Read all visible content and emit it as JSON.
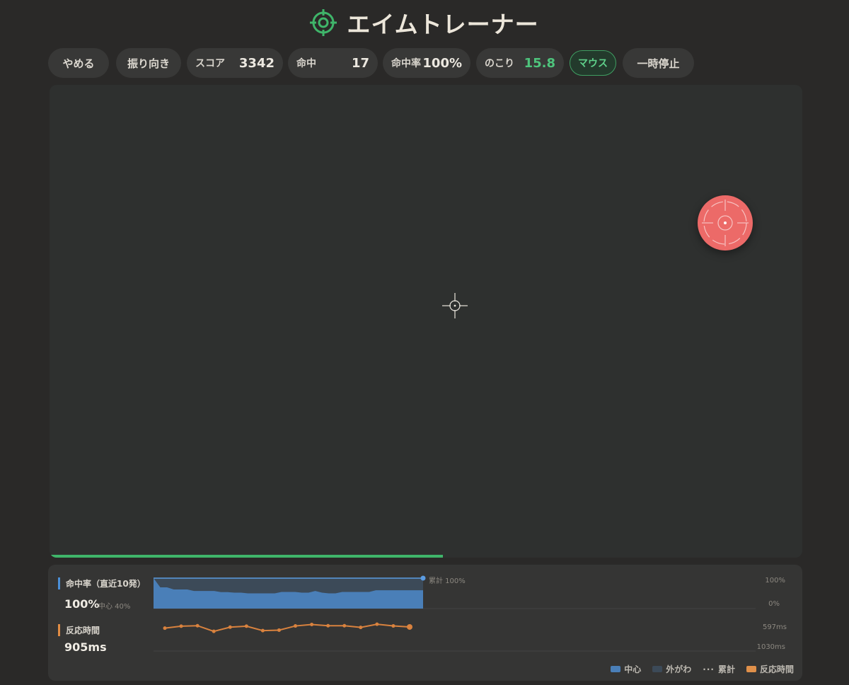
{
  "app": {
    "title": "エイムトレーナー",
    "accent": "#3fb56a"
  },
  "toolbar": {
    "quit_label": "やめる",
    "mode_select_label": "振り向き",
    "score_label": "スコア",
    "score_value": "3342",
    "hits_label": "命中",
    "hits_value": "17",
    "accuracy_label": "命中率",
    "accuracy_value": "100%",
    "remaining_label": "のこり",
    "remaining_value": "15.8",
    "input_mode_label": "マウス",
    "pause_label": "一時停止"
  },
  "arena": {
    "background": "#2e302f",
    "target_color": "#ec6a68",
    "target_icon": "target-icon",
    "cursor_icon": "crosshair-icon",
    "time_progress": 0.523
  },
  "stats": {
    "accuracy": {
      "label": "命中率（直近10発）",
      "value": "100%",
      "sub": "中心 40%",
      "cumulative_label": "累計 100%",
      "axis_top": "100%",
      "axis_bottom": "0%"
    },
    "reaction": {
      "label": "反応時間",
      "value": "905ms",
      "axis_top": "597ms",
      "axis_bottom": "1030ms"
    },
    "legend": {
      "center": "中心",
      "outer": "外がわ",
      "cumulative": "累計",
      "reaction": "反応時間"
    }
  },
  "chart_data": [
    {
      "type": "area",
      "title": "命中率（直近10発）",
      "ylim": [
        0,
        100
      ],
      "series": [
        {
          "name": "中心",
          "values": [
            100,
            62,
            62,
            53,
            53,
            53,
            47,
            47,
            47,
            47,
            42,
            42,
            40,
            40,
            37,
            37,
            37,
            37,
            37,
            43,
            43,
            43,
            40,
            40,
            47,
            40,
            37,
            37,
            43,
            43,
            43,
            43,
            43,
            50,
            50,
            50,
            50,
            50,
            50,
            50,
            50
          ]
        },
        {
          "name": "外がわ",
          "values": [
            100,
            100,
            100,
            100,
            100,
            100,
            100,
            100,
            100,
            100,
            100,
            100,
            100,
            100,
            100,
            100,
            100,
            100,
            100,
            100,
            100,
            100,
            100,
            100,
            100,
            100,
            100,
            100,
            100,
            100,
            100,
            100,
            100,
            100,
            100,
            100,
            100,
            100,
            100,
            100,
            100
          ]
        },
        {
          "name": "累計",
          "values": [
            100,
            100,
            100,
            100,
            100,
            100,
            100,
            100,
            100,
            100,
            100,
            100,
            100,
            100,
            100,
            100,
            100,
            100,
            100,
            100,
            100,
            100,
            100,
            100,
            100,
            100,
            100,
            100,
            100,
            100,
            100,
            100,
            100,
            100,
            100,
            100,
            100,
            100,
            100,
            100,
            100
          ]
        }
      ]
    },
    {
      "type": "line",
      "title": "反応時間",
      "ylim": [
        597,
        1030
      ],
      "series": [
        {
          "name": "反応時間",
          "values": [
            650,
            610,
            600,
            715,
            630,
            610,
            700,
            690,
            605,
            575,
            600,
            600,
            635,
            570,
            605,
            625
          ]
        }
      ]
    }
  ]
}
